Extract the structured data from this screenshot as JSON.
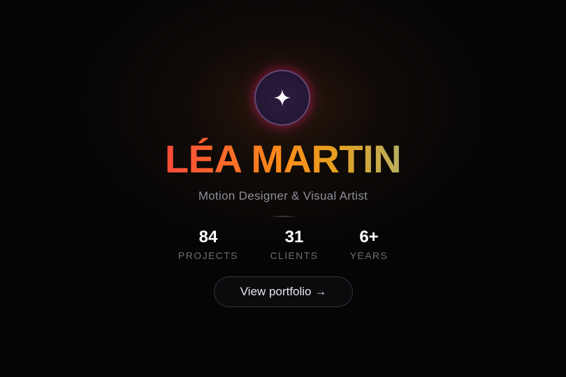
{
  "profile": {
    "avatar_icon": "sparkle-icon",
    "name": "LÉA MARTIN",
    "subtitle": "Motion Designer & Visual Artist"
  },
  "stats": [
    {
      "value": "84",
      "label": "PROJECTS"
    },
    {
      "value": "31",
      "label": "CLIENTS"
    },
    {
      "value": "6+",
      "label": "YEARS"
    }
  ],
  "cta": {
    "label": "View portfolio →"
  },
  "colors": {
    "background": "#050506",
    "name_gradient_start": "#ff4a3a",
    "name_gradient_mid": "#ff8c1a",
    "name_gradient_end": "#b9b060",
    "avatar_glow": "#be1e5a",
    "subtitle": "#8e8e9a",
    "stat_label": "#6e6e7a"
  }
}
